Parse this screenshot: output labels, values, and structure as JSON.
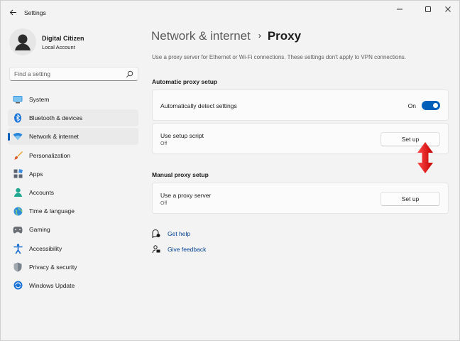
{
  "window": {
    "title": "Settings",
    "controls": {
      "minimize": "—",
      "maximize": "☐",
      "close": "✕"
    }
  },
  "profile": {
    "name": "Digital Citizen",
    "account_type": "Local Account"
  },
  "search": {
    "placeholder": "Find a setting"
  },
  "sidebar": {
    "items": [
      {
        "label": "System",
        "icon": "system-icon"
      },
      {
        "label": "Bluetooth & devices",
        "icon": "bluetooth-icon"
      },
      {
        "label": "Network & internet",
        "icon": "wifi-icon",
        "selected": true
      },
      {
        "label": "Personalization",
        "icon": "brush-icon"
      },
      {
        "label": "Apps",
        "icon": "apps-icon"
      },
      {
        "label": "Accounts",
        "icon": "accounts-icon"
      },
      {
        "label": "Time & language",
        "icon": "globe-icon"
      },
      {
        "label": "Gaming",
        "icon": "gamepad-icon"
      },
      {
        "label": "Accessibility",
        "icon": "accessibility-icon"
      },
      {
        "label": "Privacy & security",
        "icon": "shield-icon"
      },
      {
        "label": "Windows Update",
        "icon": "update-icon"
      }
    ]
  },
  "header": {
    "parent": "Network & internet",
    "separator": "›",
    "current": "Proxy",
    "description": "Use a proxy server for Ethernet or Wi-Fi connections. These settings don't apply to VPN connections."
  },
  "automatic": {
    "heading": "Automatic proxy setup",
    "detect": {
      "label": "Automatically detect settings",
      "state": "On",
      "on": true
    },
    "script": {
      "label": "Use setup script",
      "status": "Off",
      "button": "Set up"
    }
  },
  "manual": {
    "heading": "Manual proxy setup",
    "proxy": {
      "label": "Use a proxy server",
      "status": "Off",
      "button": "Set up"
    }
  },
  "links": {
    "help": "Get help",
    "feedback": "Give feedback"
  },
  "colors": {
    "accent": "#005fb8",
    "link": "#003e92",
    "annotation_arrow": "#e8141b"
  }
}
